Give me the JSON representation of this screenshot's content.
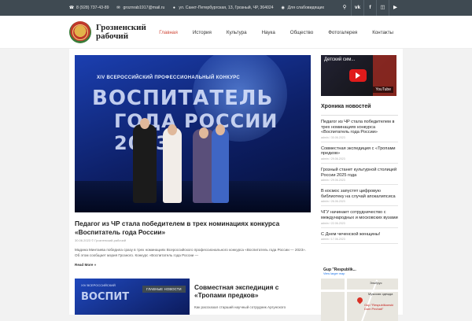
{
  "topbar": {
    "phone": "8 (928) 737-43-89",
    "email": "groznrab1917@mail.ru",
    "address": "ул. Санкт-Петербургская, 13, Грозный, ЧР, 364024",
    "accessibility": "Для слабовидящих"
  },
  "header": {
    "brand_line1": "Грозненский",
    "brand_line2": "рабочий"
  },
  "nav": [
    "Главная",
    "История",
    "Культура",
    "Наука",
    "Общество",
    "Фотогалерея",
    "Контакты"
  ],
  "featured": {
    "image_headline": "XIV ВСЕРОССИЙСКИЙ ПРОФЕССИОНАЛЬНЫЙ КОНКУРС",
    "image_big1": "ВОСПИТАТЕЛЬ",
    "image_big2": "ГОДА РОССИИ 2023",
    "title": "Педагог из ЧР стала победителем в трех номинациях конкурса «Воспитатель года России»",
    "meta": "30.06.2023 © Грозненский-рабочий",
    "description": "Мадина Минтаева победила сразу в трех номинациях Всероссийского профессионального конкурса «Воспитатель года России — 2023». Об этом сообщает мэрия Грозного. Конкурс «Воспитатель года России —",
    "read_more": "Read More »"
  },
  "second": {
    "badge": "ГЛАВНЫЕ НОВОСТИ",
    "image_top": "XIV ВСЕРОССИЙСКИЙ",
    "image_big": "ВОСПИТ",
    "title": "Совместная экспедиция с «Тропами предков»",
    "description": "Как рассказал старший научный сотрудник Аргунского"
  },
  "video": {
    "title": "Детский сим...",
    "brand": "YouTube"
  },
  "chronicle": {
    "title": "Хроника новостей",
    "items": [
      {
        "title": "Педагог из ЧР стала победителем в трех номинациях конкурса «Воспитатель года России»",
        "meta": "admin / 30.06.2023"
      },
      {
        "title": "Совместная экспедиция с «Тропами предков»",
        "meta": "admin / 29.06.2023"
      },
      {
        "title": "Грозный станет культурной столицей России 2025 года",
        "meta": "admin / 29.06.2023"
      },
      {
        "title": "В космос запустят цифровую библиотеку на случай апокалипсиса",
        "meta": "admin / 26.06.2023"
      },
      {
        "title": "ЧГУ начинает сотрудничество с международных и московских вузами",
        "meta": "admin / 22.06.2023"
      },
      {
        "title": "С Днем чеченской женщины!",
        "meta": "admin / 17.06.2023"
      }
    ]
  },
  "map": {
    "place": "Gup \"Respublik...",
    "link": "View larger map",
    "pin_label": "Gup \"Respublikanski Dom Pechati\"",
    "area1": "Эльбрус",
    "area2": "Мужская одежда"
  },
  "colors": {
    "topbar": "#3f4a52",
    "accent": "#d04a3a",
    "page_bg": "#f2f2f2"
  }
}
